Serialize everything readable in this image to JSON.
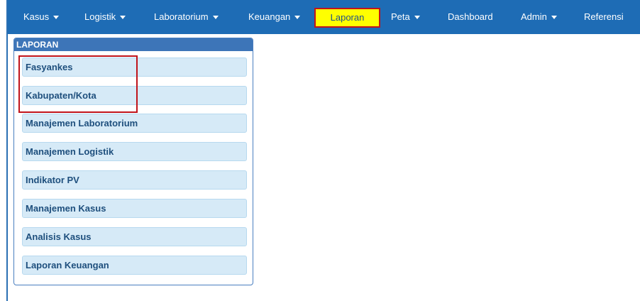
{
  "navbar": {
    "items": [
      {
        "label": "Kasus",
        "dropdown": true
      },
      {
        "label": "Logistik",
        "dropdown": true
      },
      {
        "label": "Laboratorium",
        "dropdown": true
      },
      {
        "label": "Keuangan",
        "dropdown": true
      },
      {
        "label": "Laporan",
        "dropdown": false,
        "active": true
      },
      {
        "label": "Peta",
        "dropdown": true
      },
      {
        "label": "Dashboard",
        "dropdown": false
      },
      {
        "label": "Admin",
        "dropdown": true
      },
      {
        "label": "Referensi",
        "dropdown": false
      }
    ]
  },
  "panel": {
    "title": "LAPORAN",
    "items": [
      {
        "label": "Fasyankes"
      },
      {
        "label": "Kabupaten/Kota"
      },
      {
        "label": "Manajemen Laboratorium"
      },
      {
        "label": "Manajemen Logistik"
      },
      {
        "label": "Indikator PV"
      },
      {
        "label": "Manajemen Kasus"
      },
      {
        "label": "Analisis Kasus"
      },
      {
        "label": "Laporan Keuangan"
      }
    ]
  },
  "colors": {
    "navbar": "#1e6cb5",
    "active_bg": "#ffff00",
    "highlight_border": "#c0141b",
    "panel_header": "#3d75b8",
    "menu_item_bg": "#d6eaf7",
    "menu_item_text": "#1e4f7d"
  },
  "icons": {
    "dropdown": "caret-down-icon"
  }
}
